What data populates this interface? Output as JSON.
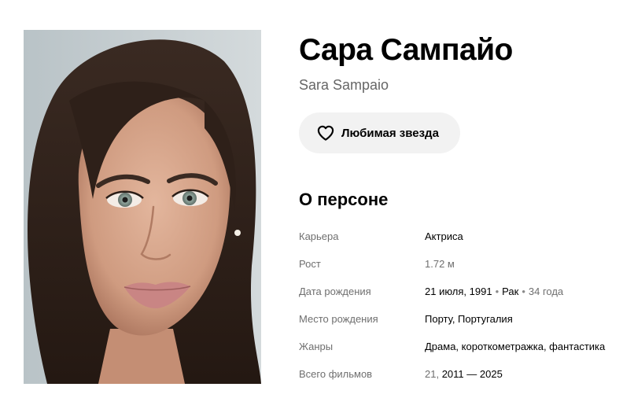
{
  "person": {
    "name_ru": "Сара Сампайо",
    "name_original": "Sara Sampaio",
    "photo_icon": "portrait-photo"
  },
  "favorite_button": {
    "label": "Любимая звезда",
    "icon": "heart-icon"
  },
  "about": {
    "title": "О персоне",
    "career": {
      "label": "Карьера",
      "value": "Актриса"
    },
    "height": {
      "label": "Рост",
      "value": "1.72 м"
    },
    "birth_date": {
      "label": "Дата рождения",
      "date": "21 июля, 1991",
      "zodiac": "Рак",
      "age": "34 года",
      "separator": "•"
    },
    "birth_place": {
      "label": "Место рождения",
      "value": "Порту, Португалия"
    },
    "genres": {
      "label": "Жанры",
      "value": "Драма, короткометражка, фантастика"
    },
    "total_films": {
      "label": "Всего фильмов",
      "count": "21,",
      "years": "2011 — 2025"
    }
  },
  "colors": {
    "button_bg": "#f2f2f2",
    "muted_text": "#6f6f6f",
    "original_name_text": "#666666"
  }
}
